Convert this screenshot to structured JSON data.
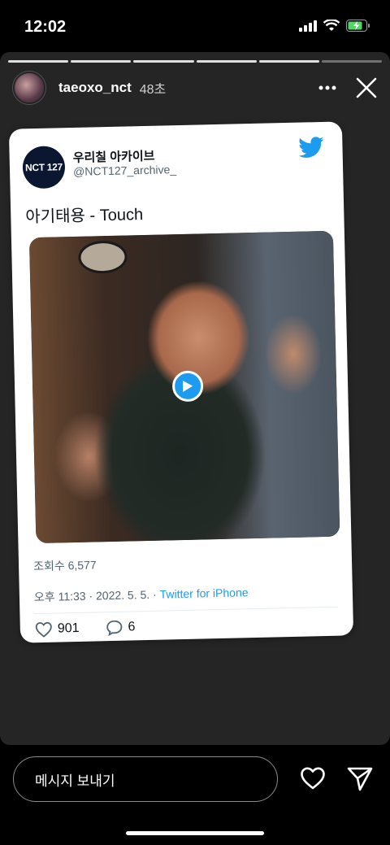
{
  "status_bar": {
    "time": "12:02",
    "icons": [
      "signal-icon",
      "wifi-icon",
      "battery-charging-icon"
    ]
  },
  "story": {
    "username": "taeoxo_nct",
    "time_ago": "48초",
    "progress": {
      "segments": 6,
      "current": 6
    }
  },
  "tweet": {
    "display_name": "우리칠 아카이브",
    "handle": "@NCT127_archive_",
    "avatar_text": "NCT 127",
    "text": "아기태용 - Touch",
    "views": "조회수 6,577",
    "timestamp": "오후 11:33 · 2022. 5. 5. · ",
    "source": "Twitter for iPhone",
    "likes": "901",
    "replies": "6"
  },
  "bottom": {
    "message_placeholder": "메시지 보내기"
  },
  "colors": {
    "twitter_blue": "#1d9bf0",
    "story_bg": "#252525"
  }
}
